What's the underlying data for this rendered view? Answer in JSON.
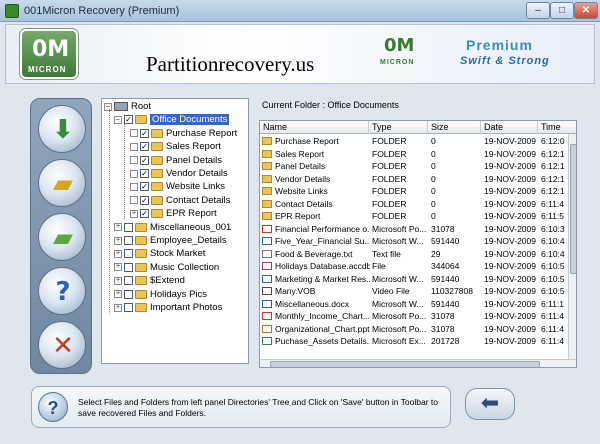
{
  "window": {
    "title": "001Micron Recovery (Premium)",
    "min": "–",
    "max": "□",
    "close": "✕"
  },
  "header": {
    "logo_mark": "0M",
    "logo_word": "MICRON",
    "site": "Partitionrecovery.us",
    "logo2_mark": "0M",
    "logo2_word": "MICRON",
    "premium": "Premium",
    "tagline": "Swift & Strong"
  },
  "toolbar": {
    "buttons": [
      {
        "name": "scan-drive",
        "icon": "disk-download-icon",
        "glyph": "⬇",
        "color": "#3a8a3a"
      },
      {
        "name": "open-folder",
        "icon": "folder-open-icon",
        "glyph": "▰",
        "color": "#d4a520"
      },
      {
        "name": "save",
        "icon": "folder-save-icon",
        "glyph": "▰",
        "color": "#5fa640"
      },
      {
        "name": "help",
        "icon": "help-icon",
        "glyph": "?",
        "color": "#2e5fb3"
      },
      {
        "name": "exit",
        "icon": "close-icon",
        "glyph": "✕",
        "color": "#c83a2a"
      }
    ]
  },
  "tree": {
    "root": "Root",
    "selected": "Office Documents",
    "children": [
      "Purchase Report",
      "Sales Report",
      "Panel Details",
      "Vendor Details",
      "Website Links",
      "Contact Details",
      "EPR Report"
    ],
    "siblings": [
      "Miscellaneous_001",
      "Employee_Details",
      "Stock Market",
      "Music Collection",
      "$Extend",
      "Holidays Pics",
      "Important Photos"
    ]
  },
  "current_folder": "Current Folder : Office Documents",
  "columns": [
    "Name",
    "Type",
    "Size",
    "Date",
    "Time"
  ],
  "files": [
    {
      "name": "Purchase Report",
      "type": "FOLDER",
      "size": "0",
      "date": "19-NOV-2009",
      "time": "6:12:0",
      "icon": "folder"
    },
    {
      "name": "Sales Report",
      "type": "FOLDER",
      "size": "0",
      "date": "19-NOV-2009",
      "time": "6:12:1",
      "icon": "folder"
    },
    {
      "name": "Panel Details",
      "type": "FOLDER",
      "size": "0",
      "date": "19-NOV-2009",
      "time": "6:12:1",
      "icon": "folder"
    },
    {
      "name": "Vendor Details",
      "type": "FOLDER",
      "size": "0",
      "date": "19-NOV-2009",
      "time": "6:12:1",
      "icon": "folder"
    },
    {
      "name": "Website Links",
      "type": "FOLDER",
      "size": "0",
      "date": "19-NOV-2009",
      "time": "6:12:1",
      "icon": "folder"
    },
    {
      "name": "Contact Details",
      "type": "FOLDER",
      "size": "0",
      "date": "19-NOV-2009",
      "time": "6:11:4",
      "icon": "folder"
    },
    {
      "name": "EPR Report",
      "type": "FOLDER",
      "size": "0",
      "date": "19-NOV-2009",
      "time": "6:11:5",
      "icon": "folder"
    },
    {
      "name": "Financial Performance o...",
      "type": "Microsoft Po...",
      "size": "31078",
      "date": "19-NOV-2009",
      "time": "6:10:3",
      "icon": "pdf"
    },
    {
      "name": "Five_Year_Financial Su...",
      "type": "Microsoft W...",
      "size": "591440",
      "date": "19-NOV-2009",
      "time": "6:10:4",
      "icon": "doc"
    },
    {
      "name": "Food & Beverage.txt",
      "type": "Text file",
      "size": "29",
      "date": "19-NOV-2009",
      "time": "6:10:4",
      "icon": "txt"
    },
    {
      "name": "Holidays Database.accdb",
      "type": "File",
      "size": "344064",
      "date": "19-NOV-2009",
      "time": "6:10:5",
      "icon": "db"
    },
    {
      "name": "Marketing & Market Res...",
      "type": "Microsoft W...",
      "size": "591440",
      "date": "19-NOV-2009",
      "time": "6:10:5",
      "icon": "doc"
    },
    {
      "name": "Many.VOB",
      "type": "Video File",
      "size": "110327808",
      "date": "19-NOV-2009",
      "time": "6:10:5",
      "icon": "vid"
    },
    {
      "name": "Miscellaneous.docx",
      "type": "Microsoft W...",
      "size": "591440",
      "date": "19-NOV-2009",
      "time": "6:11:1",
      "icon": "doc"
    },
    {
      "name": "Monthly_Income_Chart....",
      "type": "Microsoft Po...",
      "size": "31078",
      "date": "19-NOV-2009",
      "time": "6:11:4",
      "icon": "pdf"
    },
    {
      "name": "Organizational_Chart.pptx",
      "type": "Microsoft Po...",
      "size": "31078",
      "date": "19-NOV-2009",
      "time": "6:11:4",
      "icon": "ppt"
    },
    {
      "name": "Puchase_Assets Details....",
      "type": "Microsoft Ex...",
      "size": "201728",
      "date": "19-NOV-2009",
      "time": "6:11:4",
      "icon": "xls"
    }
  ],
  "footer": {
    "help_glyph": "?",
    "message": "Select Files and Folders from left panel Directories' Tree and Click on 'Save' button in Toolbar to save recovered Files and Folders.",
    "back_glyph": "⬅"
  }
}
